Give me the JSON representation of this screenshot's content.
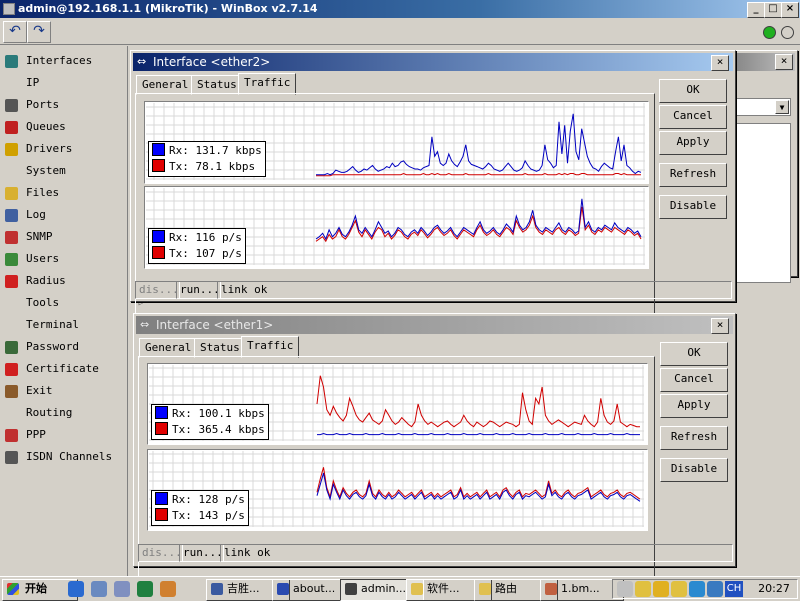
{
  "app": {
    "title": "admin@192.168.1.1 (MikroTik) - WinBox v2.7.14"
  },
  "titlebar_buttons": {
    "minimize": "_",
    "maximize": "□",
    "close": "×"
  },
  "toolbar": {
    "undo": "↶",
    "redo": "↷"
  },
  "sidebar": {
    "items": [
      {
        "label": "Interfaces",
        "icon": "interfaces-icon",
        "color": "#2a7a7a",
        "submenu": false
      },
      {
        "label": "IP",
        "icon": "",
        "color": "",
        "submenu": true
      },
      {
        "label": "Ports",
        "icon": "ports-icon",
        "color": "#555555",
        "submenu": false
      },
      {
        "label": "Queues",
        "icon": "queues-icon",
        "color": "#c02020",
        "submenu": false
      },
      {
        "label": "Drivers",
        "icon": "drivers-icon",
        "color": "#d0a000",
        "submenu": false
      },
      {
        "label": "System",
        "icon": "",
        "color": "",
        "submenu": true
      },
      {
        "label": "Files",
        "icon": "files-icon",
        "color": "#d8b030",
        "submenu": false
      },
      {
        "label": "Log",
        "icon": "log-icon",
        "color": "#4060a0",
        "submenu": false
      },
      {
        "label": "SNMP",
        "icon": "snmp-icon",
        "color": "#c03030",
        "submenu": false
      },
      {
        "label": "Users",
        "icon": "users-icon",
        "color": "#3a8a3a",
        "submenu": false
      },
      {
        "label": "Radius",
        "icon": "radius-icon",
        "color": "#d02020",
        "submenu": false
      },
      {
        "label": "Tools",
        "icon": "",
        "color": "",
        "submenu": true
      },
      {
        "label": "Terminal",
        "icon": "",
        "color": "",
        "submenu": false
      },
      {
        "label": "Password",
        "icon": "password-icon",
        "color": "#3a6a3a",
        "submenu": false
      },
      {
        "label": "Certificate",
        "icon": "certificate-icon",
        "color": "#d02020",
        "submenu": false
      },
      {
        "label": "Exit",
        "icon": "exit-icon",
        "color": "#8a5a2a",
        "submenu": false
      },
      {
        "label": "Routing",
        "icon": "",
        "color": "",
        "submenu": true
      },
      {
        "label": "PPP",
        "icon": "ppp-icon",
        "color": "#c03030",
        "submenu": false
      },
      {
        "label": "ISDN Channels",
        "icon": "isdn-icon",
        "color": "#555555",
        "submenu": false
      }
    ]
  },
  "windows": [
    {
      "title": "Interface <ether2>",
      "active": true,
      "tabs": [
        "General",
        "Status",
        "Traffic"
      ],
      "selected_tab": 2,
      "buttons": [
        "OK",
        "Cancel",
        "Apply",
        "Refresh",
        "Disable"
      ],
      "status": [
        "dis...",
        "run...",
        "link ok"
      ],
      "legend_bits": {
        "rx": "Rx:  131.7 kbps",
        "tx": "Tx:  78.1 kbps"
      },
      "legend_pkts": {
        "rx": "Rx:  116 p/s",
        "tx": "Tx:  107 p/s"
      }
    },
    {
      "title": "Interface <ether1>",
      "active": false,
      "tabs": [
        "General",
        "Status",
        "Traffic"
      ],
      "selected_tab": 2,
      "buttons": [
        "OK",
        "Cancel",
        "Apply",
        "Refresh",
        "Disable"
      ],
      "status": [
        "dis...",
        "run...",
        "link ok"
      ],
      "legend_bits": {
        "rx": "Rx:  100.1 kbps",
        "tx": "Tx:  365.4 kbps"
      },
      "legend_pkts": {
        "rx": "Rx:  128 p/s",
        "tx": "Tx:  143 p/s"
      }
    }
  ],
  "colors": {
    "rx": "#0000c0",
    "tx": "#d00000",
    "rx_swatch": "#0000ff",
    "tx_swatch": "#e00000",
    "title_active": "#0a246a",
    "status_green": "#20b020"
  },
  "chart_data": [
    {
      "type": "line",
      "series": [
        {
          "name": "Rx",
          "values": [
            2,
            2,
            2,
            2,
            3,
            2,
            3,
            6,
            5,
            4,
            4,
            5,
            7,
            9,
            6,
            4,
            5,
            7,
            6,
            8,
            10,
            7,
            5,
            6,
            7,
            9,
            8,
            12,
            9,
            10,
            13,
            14,
            11,
            9,
            8,
            7,
            7,
            6,
            8,
            9,
            10,
            35,
            18,
            22,
            12,
            10,
            12,
            20,
            14,
            11,
            9,
            13,
            18,
            28,
            14,
            11,
            10,
            9,
            8,
            7,
            9,
            12,
            10,
            7,
            6,
            5,
            6,
            9,
            12,
            9,
            6,
            5,
            6,
            8,
            14,
            10,
            7,
            6,
            5,
            6,
            10,
            28,
            15,
            12,
            8,
            10,
            48,
            20,
            45,
            12,
            40,
            55,
            22,
            15,
            42,
            30,
            18,
            12,
            8,
            7,
            5,
            9,
            12,
            10,
            8,
            7,
            22,
            35,
            14,
            28,
            10,
            8,
            5,
            3,
            5,
            4
          ]
        },
        {
          "name": "Tx",
          "values": [
            1,
            1,
            1,
            1,
            1,
            1,
            2,
            2,
            2,
            2,
            2,
            2,
            2,
            2,
            2,
            2,
            2,
            2,
            2,
            2,
            2,
            2,
            2,
            2,
            2,
            2,
            2,
            2,
            2,
            2,
            2,
            3,
            2,
            2,
            2,
            2,
            2,
            2,
            3,
            2,
            2,
            3,
            2,
            3,
            2,
            2,
            2,
            3,
            2,
            2,
            2,
            2,
            2,
            3,
            2,
            2,
            2,
            2,
            2,
            2,
            2,
            3,
            2,
            2,
            2,
            2,
            2,
            2,
            2,
            2,
            2,
            2,
            2,
            2,
            3,
            2,
            2,
            2,
            2,
            2,
            2,
            3,
            2,
            2,
            2,
            2,
            3,
            2,
            3,
            2,
            3,
            3,
            2,
            2,
            3,
            3,
            2,
            2,
            2,
            2,
            2,
            2,
            2,
            2,
            2,
            2,
            3,
            3,
            2,
            3,
            2,
            2,
            2,
            2,
            2,
            2
          ]
        }
      ]
    },
    {
      "type": "line",
      "series": [
        {
          "name": "Rx",
          "values": [
            20,
            22,
            25,
            20,
            28,
            22,
            25,
            30,
            24,
            22,
            26,
            32,
            40,
            28,
            25,
            30,
            26,
            22,
            28,
            35,
            30,
            25,
            27,
            22,
            25,
            30,
            28,
            24,
            22,
            26,
            28,
            25,
            30,
            27,
            23,
            26,
            30,
            32,
            28,
            25,
            27,
            30,
            25,
            22,
            26,
            30,
            28,
            26,
            24,
            30,
            35,
            28,
            25,
            27,
            30,
            26,
            24,
            28,
            33,
            30,
            26,
            40,
            32,
            28,
            30,
            35,
            45,
            32,
            28,
            26,
            30,
            28,
            26,
            30,
            34,
            28,
            26,
            30,
            28,
            25,
            27,
            55,
            30,
            35,
            28,
            26,
            30,
            28,
            32,
            30,
            28,
            34,
            30,
            28,
            26,
            30,
            28,
            25,
            27,
            22
          ]
        },
        {
          "name": "Tx",
          "values": [
            18,
            20,
            22,
            18,
            24,
            20,
            22,
            28,
            22,
            20,
            24,
            30,
            36,
            26,
            22,
            28,
            24,
            20,
            26,
            30,
            28,
            22,
            25,
            20,
            23,
            28,
            26,
            22,
            20,
            24,
            26,
            23,
            28,
            25,
            21,
            24,
            28,
            30,
            26,
            23,
            25,
            28,
            23,
            20,
            24,
            28,
            26,
            24,
            22,
            28,
            32,
            26,
            23,
            25,
            28,
            24,
            22,
            26,
            30,
            28,
            24,
            36,
            30,
            26,
            28,
            32,
            40,
            30,
            26,
            24,
            28,
            26,
            24,
            28,
            30,
            26,
            24,
            28,
            26,
            23,
            25,
            48,
            28,
            32,
            26,
            24,
            28,
            26,
            30,
            28,
            26,
            30,
            28,
            26,
            24,
            28,
            26,
            23,
            25,
            20
          ]
        }
      ]
    },
    {
      "type": "line",
      "series": [
        {
          "name": "Rx",
          "values": [
            3,
            3,
            4,
            3,
            3,
            3,
            4,
            3,
            3,
            3,
            4,
            3,
            3,
            3,
            3,
            4,
            3,
            3,
            3,
            3,
            4,
            3,
            3,
            3,
            3,
            4,
            3,
            3,
            3,
            3,
            4,
            3,
            3,
            3,
            3,
            4,
            3,
            3,
            3,
            3,
            4,
            3,
            3,
            3,
            3,
            4,
            3,
            3,
            3,
            3,
            4,
            3,
            3,
            3,
            3,
            4,
            3,
            3,
            3,
            3,
            4,
            3,
            3,
            3,
            3,
            4,
            3,
            3,
            3,
            3,
            4,
            3,
            3,
            3,
            3,
            4,
            3,
            3,
            3,
            3,
            4,
            3,
            3,
            3,
            3,
            4,
            3,
            3,
            3,
            3,
            4,
            3,
            3,
            3,
            3,
            4,
            3,
            3,
            3,
            3
          ]
        },
        {
          "name": "Tx",
          "values": [
            30,
            55,
            45,
            25,
            20,
            28,
            22,
            18,
            15,
            20,
            35,
            28,
            20,
            16,
            14,
            18,
            22,
            16,
            14,
            12,
            15,
            25,
            20,
            15,
            12,
            14,
            18,
            15,
            12,
            10,
            14,
            30,
            20,
            15,
            12,
            14,
            12,
            10,
            12,
            14,
            15,
            12,
            10,
            12,
            14,
            20,
            15,
            12,
            10,
            14,
            12,
            10,
            12,
            15,
            14,
            12,
            10,
            12,
            14,
            13,
            12,
            10,
            12,
            40,
            25,
            15,
            12,
            35,
            30,
            45,
            20,
            15,
            12,
            14,
            16,
            14,
            12,
            10,
            12,
            14,
            13,
            12,
            20,
            15,
            12,
            10,
            14,
            35,
            20,
            14,
            12,
            15,
            30,
            14,
            12,
            10,
            12,
            11,
            10,
            10
          ]
        }
      ]
    },
    {
      "type": "line",
      "series": [
        {
          "name": "Rx",
          "values": [
            25,
            35,
            45,
            30,
            22,
            35,
            28,
            22,
            30,
            25,
            22,
            26,
            28,
            24,
            22,
            25,
            35,
            25,
            22,
            28,
            24,
            22,
            26,
            22,
            24,
            28,
            25,
            22,
            24,
            26,
            22,
            25,
            28,
            22,
            24,
            26,
            22,
            25,
            22,
            24,
            26,
            28,
            22,
            24,
            30,
            22,
            25,
            22,
            24,
            26,
            22,
            25,
            28,
            22,
            24,
            26,
            22,
            28,
            30,
            25,
            22,
            26,
            28,
            22,
            25,
            24,
            26,
            28,
            25,
            22,
            24,
            35,
            25,
            28,
            24,
            22,
            26,
            28,
            24,
            22,
            25,
            26,
            28,
            30,
            22,
            24,
            26,
            28,
            24,
            22,
            25,
            26,
            28,
            24,
            22,
            25,
            26,
            24,
            22,
            20
          ]
        },
        {
          "name": "Tx",
          "values": [
            28,
            40,
            50,
            32,
            24,
            38,
            30,
            24,
            32,
            27,
            24,
            28,
            30,
            26,
            24,
            27,
            38,
            27,
            24,
            30,
            26,
            24,
            28,
            24,
            26,
            30,
            27,
            24,
            26,
            28,
            24,
            27,
            30,
            24,
            26,
            28,
            24,
            27,
            24,
            26,
            28,
            30,
            24,
            26,
            32,
            24,
            27,
            24,
            26,
            28,
            24,
            27,
            30,
            24,
            26,
            28,
            24,
            30,
            32,
            27,
            24,
            28,
            30,
            24,
            27,
            26,
            28,
            30,
            27,
            24,
            26,
            38,
            27,
            30,
            26,
            24,
            28,
            30,
            26,
            24,
            27,
            28,
            30,
            32,
            24,
            26,
            28,
            30,
            26,
            24,
            27,
            28,
            30,
            26,
            24,
            27,
            28,
            26,
            24,
            22
          ]
        }
      ]
    }
  ],
  "taskbar": {
    "start": "开始",
    "tasks": [
      {
        "label": "吉胜...",
        "icon": "app-icon"
      },
      {
        "label": "about...",
        "icon": "word-icon"
      },
      {
        "label": "admin...",
        "icon": "winbox-icon"
      },
      {
        "label": "软件...",
        "icon": "folder-icon"
      },
      {
        "label": "路由",
        "icon": "folder-icon"
      },
      {
        "label": "1.bm...",
        "icon": "paint-icon"
      }
    ],
    "lang": "CH",
    "clock": "20:27"
  }
}
